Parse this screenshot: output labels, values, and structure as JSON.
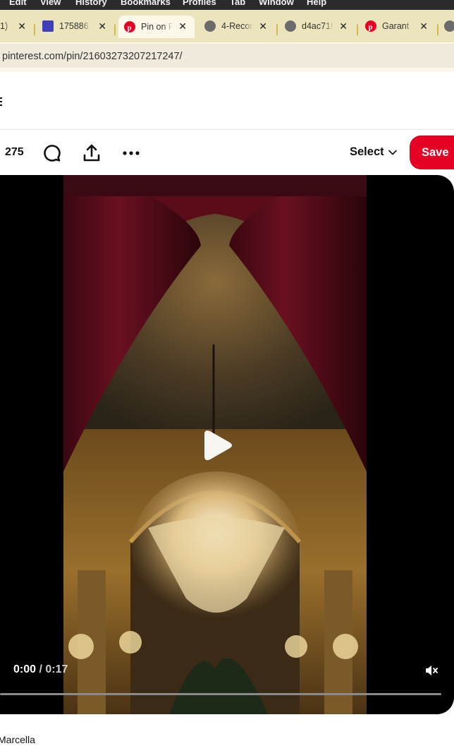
{
  "menubar": {
    "items": [
      "Edit",
      "View",
      "History",
      "Bookmarks",
      "Profiles",
      "Tab",
      "Window",
      "Help"
    ]
  },
  "tabs": [
    {
      "label": "1)",
      "icon": "page-icon"
    },
    {
      "label": "175886",
      "icon": "site-icon"
    },
    {
      "label": "Pin on P",
      "icon": "pinterest-icon",
      "active": true
    },
    {
      "label": "4-Recor",
      "icon": "globe-icon"
    },
    {
      "label": "d4ac71f",
      "icon": "globe-icon"
    },
    {
      "label": "Garant",
      "icon": "pinterest-icon"
    }
  ],
  "address": {
    "url": "pinterest.com/pin/21603273207217247/"
  },
  "actions": {
    "reaction_count": "275",
    "select_label": "Select",
    "save_label": "Save"
  },
  "video": {
    "current_time": "0:00",
    "separator": "/",
    "duration": "0:17",
    "progress": 0,
    "muted": true
  },
  "author": {
    "name": "Marcella"
  },
  "colors": {
    "accent": "#e60023",
    "tab_bar": "#ece4bd",
    "tab_separator": "#d6b94c"
  }
}
